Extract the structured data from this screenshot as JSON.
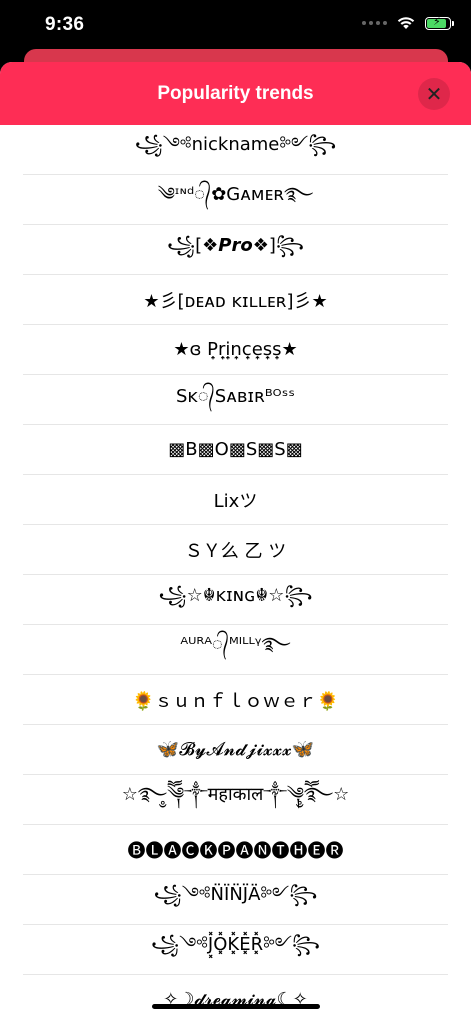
{
  "status_bar": {
    "time": "9:36",
    "wifi_icon": "wifi-icon",
    "battery_icon": "battery-charging-icon",
    "battery_color": "#4cd964"
  },
  "sheet": {
    "title": "Popularity trends",
    "header_color": "#fe2d55",
    "close_icon": "close-icon",
    "close_label": "✕"
  },
  "names": [
    "꧁༺nickname༻꧂",
    "༄ᶦᶰᵈ᭄✿Gᴀᴍᴇʀ࿐",
    "꧁[❖𝙋𝙧𝙤❖]꧂",
    "★彡[ᴅᴇᴀᴅ ᴋɪʟʟᴇʀ]彡★",
    "★ɞ P͎̣r͎̣i͎̣n͎̣c͎̣e͎̣s͎̣s͎̣★",
    "Sᴋ᭄Sᴀʙɪʀᴮᴼˢˢ",
    "▩B▩O▩S▩S▩",
    "Lixツ",
    "ＳＹ么 乙 ツ",
    "꧁☆☬ᴋɪɴɢ☬☆꧂",
    "ᴬᵁᴿᴬ᭄ᴹᴵᴸᴸᵞ࿐",
    "🌻ｓｕｎｆｌｏｗｅｒ🌻",
    "🦋𝓑𝔂𝓐𝓷𝓭𝓳𝓲𝔁𝔁𝔁🦋",
    "☆࿐ཽ༵༆༒महाकाल༒༆ཽ༵࿐☆",
    "🅑🅛🅐🅒🅚🅟🅐🅝🅣🅗🅔🅡",
    "꧁༺N̈ÏN̈J̈Ä༻꧂",
    "꧁༺J͓̽O͓̽K͓̽E͓̽R͓̽༻꧂",
    "✧☽𝓭𝓻𝓮𝓪𝓶𝓲𝓷𝓰☾✧"
  ]
}
